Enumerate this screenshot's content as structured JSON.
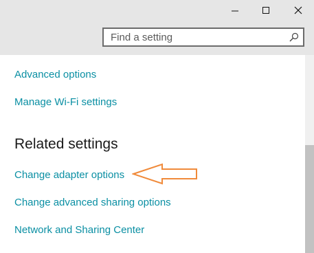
{
  "window": {
    "minimize_icon": "minimize-icon",
    "maximize_icon": "maximize-icon",
    "close_icon": "close-icon"
  },
  "search": {
    "placeholder": "Find a setting",
    "icon": "search-icon"
  },
  "links": {
    "advanced_options": "Advanced options",
    "manage_wifi": "Manage Wi-Fi settings"
  },
  "related": {
    "heading": "Related settings",
    "change_adapter": "Change adapter options",
    "change_sharing": "Change advanced sharing options",
    "network_center": "Network and Sharing Center"
  },
  "colors": {
    "link": "#0a8fa3",
    "titlebar_bg": "#e6e6e6",
    "annotation_arrow": "#f08a3a"
  }
}
